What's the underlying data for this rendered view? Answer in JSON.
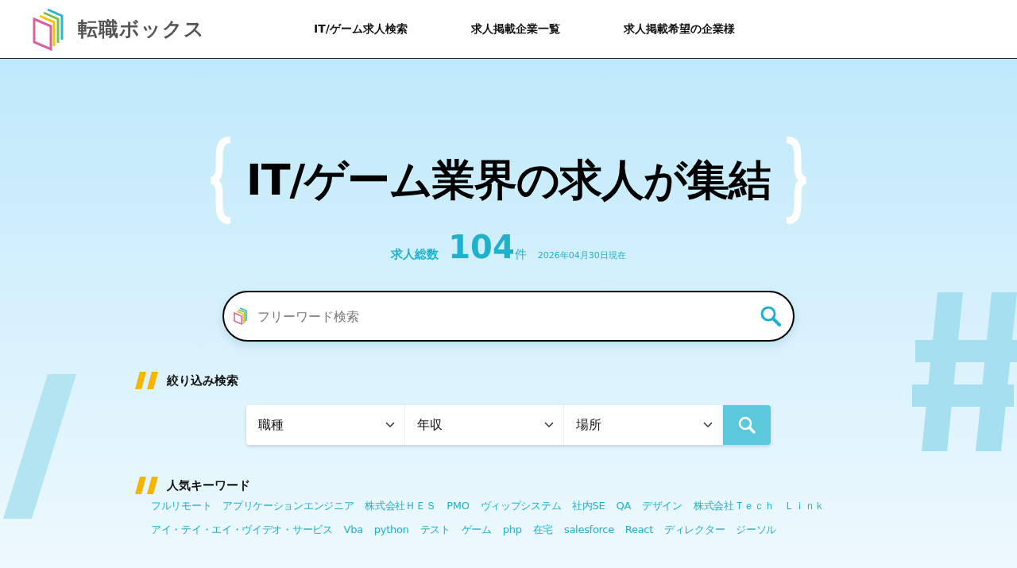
{
  "header": {
    "logo": "転職ボックス",
    "nav": [
      {
        "label": "IT/ゲーム求人検索"
      },
      {
        "label": "求人掲載企業一覧"
      },
      {
        "label": "求人掲載希望の企業様"
      }
    ]
  },
  "hero": {
    "title": "IT/ゲーム業界の求人が集結",
    "count_label": "求人総数",
    "count": "104",
    "count_unit": "件",
    "as_of": "2026年04月30日現在"
  },
  "search": {
    "placeholder": "フリーワード検索"
  },
  "filter": {
    "heading": "絞り込み検索",
    "selects": [
      {
        "label": "職種"
      },
      {
        "label": "年収"
      },
      {
        "label": "場所"
      }
    ]
  },
  "keywords": {
    "heading": "人気キーワード",
    "items": [
      "フルリモート",
      "アプリケーションエンジニア",
      "株式会社ＨＥＳ",
      "PMO",
      "ヴィップシステム",
      "社内SE",
      "QA",
      "デザイン",
      "株式会社Ｔｅｃｈ　Ｌｉｎｋ",
      "アイ・テイ・エイ・ヴイデオ・サービス",
      "Vba",
      "python",
      "テスト",
      "ゲーム",
      "php",
      "在宅",
      "salesforce",
      "React",
      "ディレクター",
      "ジーソル"
    ]
  }
}
